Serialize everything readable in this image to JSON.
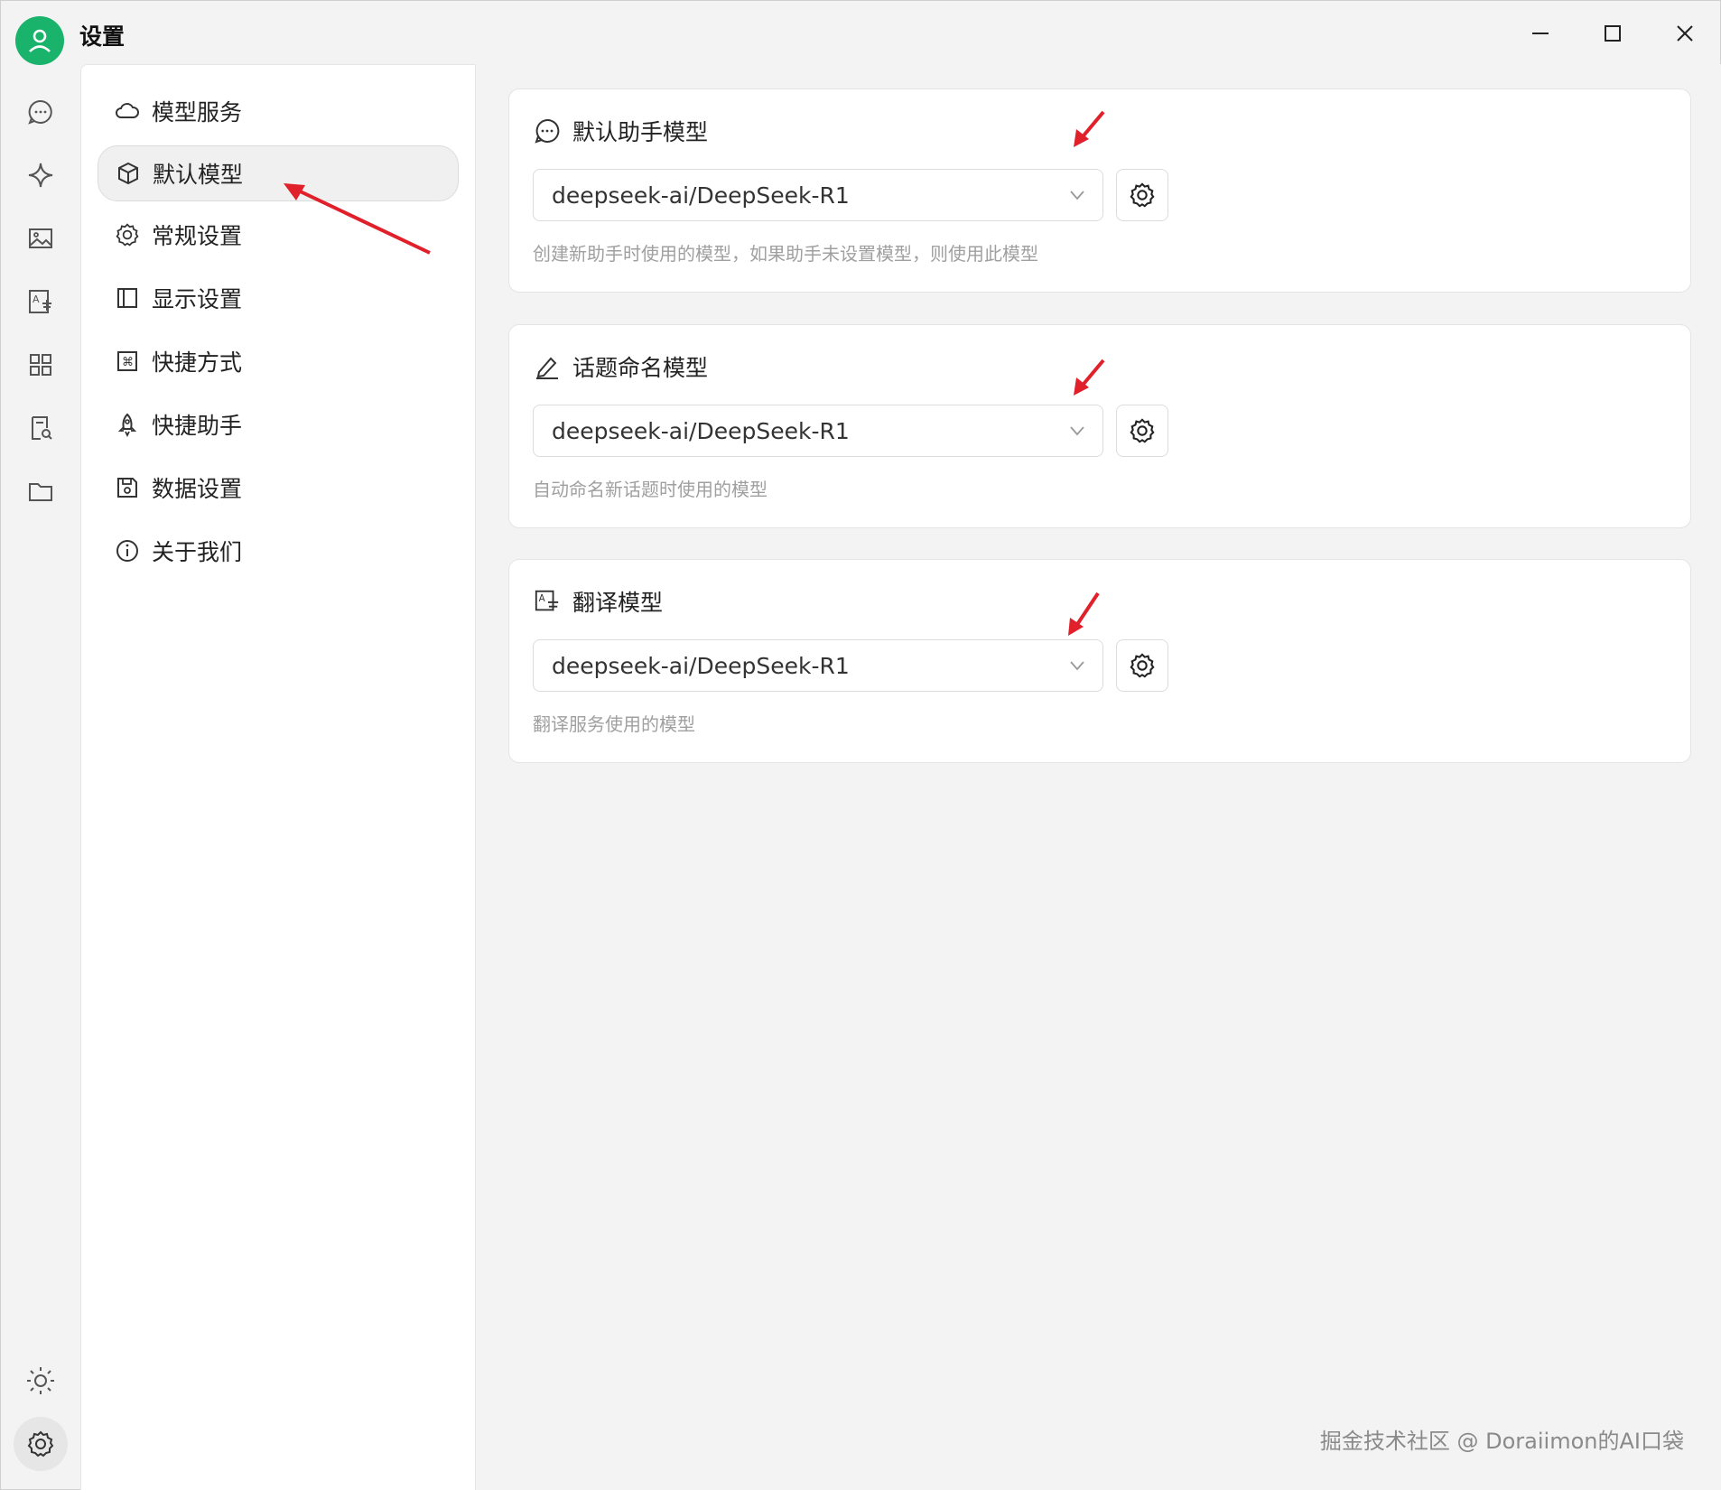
{
  "window": {
    "title": "设置",
    "controls": [
      "minimize-icon",
      "maximize-icon",
      "close-icon"
    ]
  },
  "rail": {
    "items": [
      "chat-icon",
      "sparkle-icon",
      "image-icon",
      "translate-icon",
      "grid-icon",
      "document-search-icon",
      "folder-icon"
    ],
    "bottom": [
      "theme-sun-icon",
      "settings-gear-icon"
    ],
    "active": "settings-gear-icon"
  },
  "nav": {
    "items": [
      {
        "label": "模型服务",
        "icon": "cloud-icon"
      },
      {
        "label": "默认模型",
        "icon": "cube-icon"
      },
      {
        "label": "常规设置",
        "icon": "gear-icon"
      },
      {
        "label": "显示设置",
        "icon": "layout-icon"
      },
      {
        "label": "快捷方式",
        "icon": "command-icon"
      },
      {
        "label": "快捷助手",
        "icon": "rocket-icon"
      },
      {
        "label": "数据设置",
        "icon": "save-icon"
      },
      {
        "label": "关于我们",
        "icon": "info-icon"
      }
    ],
    "active_index": 1
  },
  "cards": [
    {
      "title": "默认助手模型",
      "icon": "chat-bubble-icon",
      "value": "deepseek-ai/DeepSeek-R1",
      "description": "创建新助手时使用的模型，如果助手未设置模型，则使用此模型"
    },
    {
      "title": "话题命名模型",
      "icon": "pencil-icon",
      "value": "deepseek-ai/DeepSeek-R1",
      "description": "自动命名新话题时使用的模型"
    },
    {
      "title": "翻译模型",
      "icon": "translate-icon",
      "value": "deepseek-ai/DeepSeek-R1",
      "description": "翻译服务使用的模型"
    }
  ],
  "colors": {
    "accent_green": "#19b36b",
    "annotation_red": "#e0202a"
  },
  "watermark": "掘金技术社区 @ Doraiimon的AI口袋"
}
